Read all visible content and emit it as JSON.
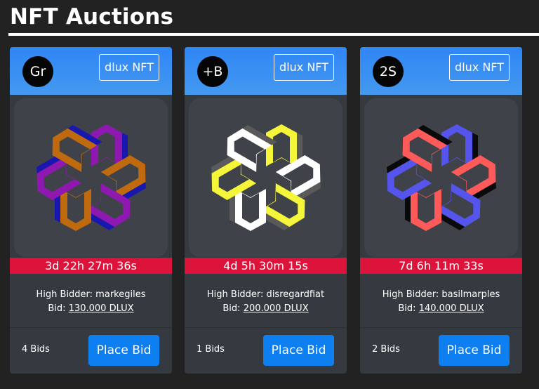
{
  "page": {
    "title": "NFT Auctions"
  },
  "cards": [
    {
      "avatar": "Gr",
      "badge": "dlux NFT",
      "timer": "3d 22h 27m 36s",
      "high_bidder": "High Bidder: markegiles",
      "bid_label": "Bid: ",
      "bid_amount": "130.000 DLUX",
      "bids_count": "4 Bids",
      "place_bid": "Place Bid",
      "colors": {
        "a": "#8e18b0",
        "b": "#c06a10",
        "c": "#1818b0"
      }
    },
    {
      "avatar": "+B",
      "badge": "dlux NFT",
      "timer": "4d 5h 30m 15s",
      "high_bidder": "High Bidder: disregardfiat",
      "bid_label": "Bid: ",
      "bid_amount": "200.000 DLUX",
      "bids_count": "1 Bids",
      "place_bid": "Place Bid",
      "colors": {
        "a": "#f5f53a",
        "b": "#ffffff",
        "c": "#5a5a5a"
      }
    },
    {
      "avatar": "2S",
      "badge": "dlux NFT",
      "timer": "7d 6h 11m 33s",
      "high_bidder": "High Bidder: basilmarples",
      "bid_label": "Bid: ",
      "bid_amount": "140.000 DLUX",
      "bids_count": "2 Bids",
      "place_bid": "Place Bid",
      "colors": {
        "a": "#5555ee",
        "b": "#ff5a5a",
        "c": "#0a0a0a"
      }
    }
  ]
}
